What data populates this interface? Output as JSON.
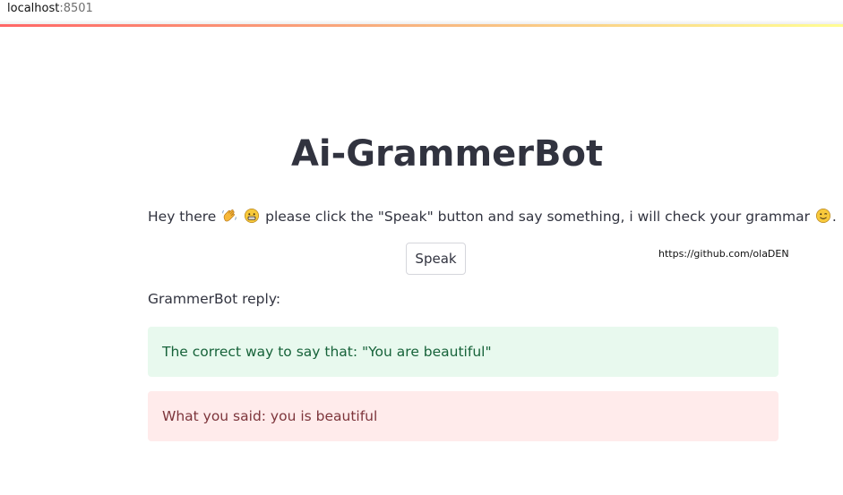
{
  "browser": {
    "address_host": "localhost",
    "address_port": ":8501"
  },
  "theme": {
    "success_bg": "#e8f9ee",
    "success_text": "#17633a",
    "error_bg": "#ffebeb",
    "error_text": "#7d353b"
  },
  "app": {
    "title": "Ai-GrammerBot",
    "intro": {
      "prefix": "Hey there",
      "emoji1": "waving-hand-emoji",
      "emoji2": "grinning-face-emoji",
      "middle": "please click the \"Speak\" button and say something, i will check your grammar",
      "emoji3": "winking-face-emoji",
      "suffix": "."
    },
    "speak_button_label": "Speak",
    "github_link": "https://github.com/olaDEN",
    "reply_label": "GrammerBot reply:",
    "correct_message": "The correct way to say that: \"You are beautiful\"",
    "said_message": "What you said: you is beautiful"
  }
}
